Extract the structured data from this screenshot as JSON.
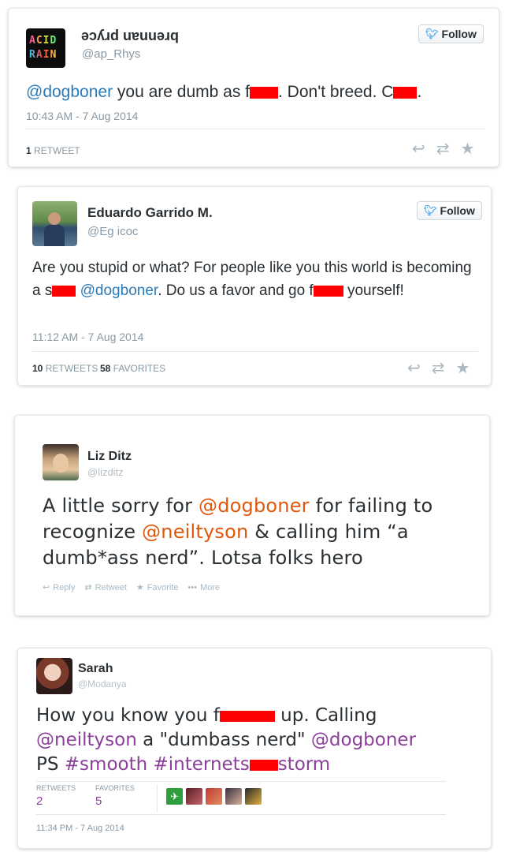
{
  "tweet1": {
    "avatar_text_top": "ACID",
    "avatar_text_bottom": "RAIN",
    "name": "brennan pryce",
    "handle": "@ap_Rhys",
    "follow_label": "Follow",
    "text_mention": "@dogboner",
    "text_part1": " you are dumb as f",
    "text_part2": ". Don't breed. C",
    "text_part3": ".",
    "timestamp": "10:43 AM - 7 Aug 2014",
    "retweets_count": "1",
    "retweets_label": "RETWEET"
  },
  "tweet2": {
    "name": "Eduardo Garrido M.",
    "handle": "@Eg  icoc",
    "follow_label": "Follow",
    "text_part1": "Are you stupid or what? For people like you this world is becoming a s",
    "text_mention": "@dogboner",
    "text_part2": ". Do us a favor and go f",
    "text_part3": "yourself!",
    "timestamp": "11:12 AM - 7 Aug 2014",
    "retweets_count": "10",
    "retweets_label": "RETWEETS",
    "favorites_count": "58",
    "favorites_label": "FAVORITES"
  },
  "tweet3": {
    "name": "Liz Ditz",
    "handle": "@lizditz",
    "text_part1": "A little sorry for ",
    "mention1": "@dogboner",
    "text_part2": " for failing to recognize ",
    "mention2": "@neiltyson",
    "text_part3": " & calling him “a dumb*ass nerd”. Lotsa folks hero",
    "actions": {
      "reply": "Reply",
      "retweet": "Retweet",
      "favorite": "Favorite",
      "more": "More"
    }
  },
  "tweet4": {
    "name": "Sarah",
    "handle": "@Modanya",
    "text_part1": "How you know you f",
    "text_part2": " up. Calling ",
    "mention1": "@neiltyson",
    "text_part3": " a \"dumbass nerd\" ",
    "mention2": "@dogboner",
    "text_part4": "PS ",
    "hashtag1": "#smooth",
    "hashtag2": "#internets",
    "hashtag2_tail": "storm",
    "retweets_label": "RETWEETS",
    "retweets_count": "2",
    "favorites_label": "FAVORITES",
    "favorites_count": "5",
    "timestamp": "11:34 PM - 7 Aug 2014"
  },
  "colors": {
    "link_blue": "#2b7bb9",
    "link_orange": "#e0570a",
    "link_purple": "#8a3f99",
    "redaction": "#ff0000"
  }
}
